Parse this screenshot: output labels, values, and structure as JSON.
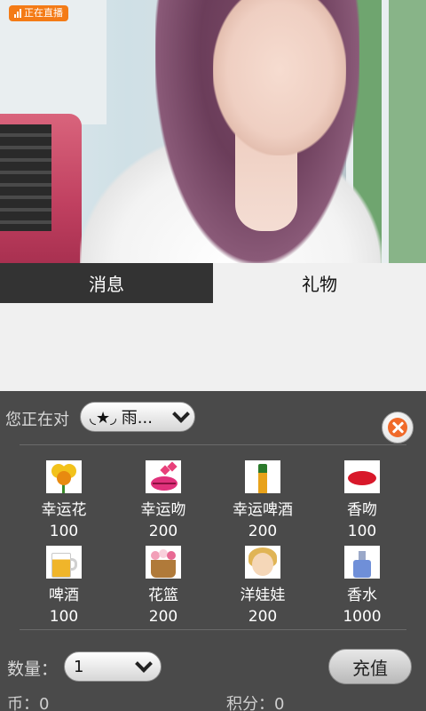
{
  "live_badge": {
    "label": "正在直播"
  },
  "tabs": [
    {
      "label": "消息",
      "active": false
    },
    {
      "label": "礼物",
      "active": true
    }
  ],
  "gift_panel": {
    "target_label": "您正在对",
    "target_value": "◟★◞ 雨...",
    "gifts": [
      {
        "name": "幸运花",
        "price": "100",
        "icon": "flower-icon"
      },
      {
        "name": "幸运吻",
        "price": "200",
        "icon": "lips-icon"
      },
      {
        "name": "幸运啤酒",
        "price": "200",
        "icon": "beer-bottle-icon"
      },
      {
        "name": "香吻",
        "price": "100",
        "icon": "kiss-icon"
      },
      {
        "name": "啤酒",
        "price": "100",
        "icon": "beer-mug-icon"
      },
      {
        "name": "花篮",
        "price": "200",
        "icon": "flower-basket-icon"
      },
      {
        "name": "洋娃娃",
        "price": "200",
        "icon": "doll-icon"
      },
      {
        "name": "香水",
        "price": "1000",
        "icon": "perfume-icon"
      }
    ],
    "quantity_label": "数量：",
    "quantity_value": "1",
    "recharge_label": "充值",
    "coins_text": "币：0",
    "points_text": "积分：0"
  },
  "colors": {
    "accent_badge": "#f47b16",
    "panel_bg": "#4a4a4a",
    "tab_inactive_bg": "#333333",
    "close_icon": "#f06a2a"
  }
}
